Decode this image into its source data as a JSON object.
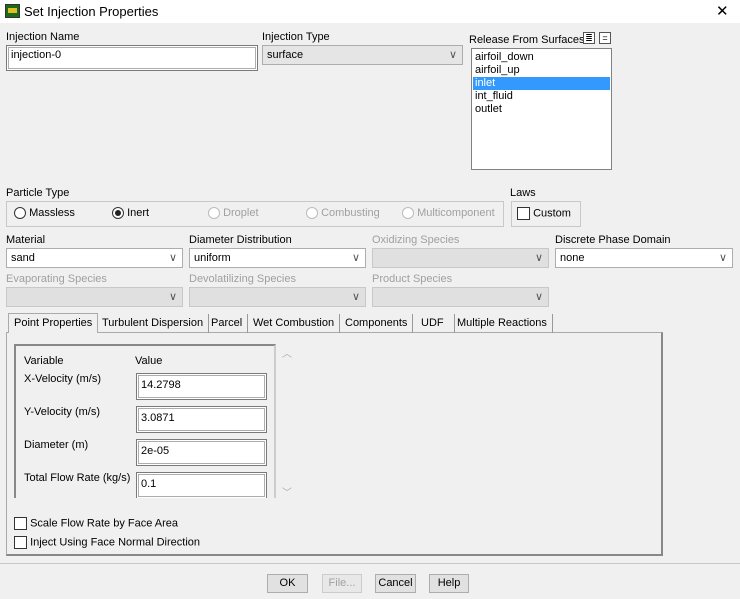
{
  "window": {
    "title": "Set Injection Properties",
    "close": "✕"
  },
  "injection_name": {
    "label": "Injection Name",
    "value": "injection-0"
  },
  "injection_type": {
    "label": "Injection Type",
    "value": "surface"
  },
  "release": {
    "label": "Release From Surfaces",
    "items": [
      "airfoil_down",
      "airfoil_up",
      "inlet",
      "int_fluid",
      "outlet"
    ],
    "selected": "inlet"
  },
  "particle_type": {
    "label": "Particle Type",
    "options": [
      "Massless",
      "Inert",
      "Droplet",
      "Combusting",
      "Multicomponent"
    ],
    "selected": "Inert"
  },
  "laws": {
    "label": "Laws",
    "custom": "Custom"
  },
  "material": {
    "label": "Material",
    "value": "sand"
  },
  "diameter_distribution": {
    "label": "Diameter Distribution",
    "value": "uniform"
  },
  "oxidizing_species": {
    "label": "Oxidizing Species",
    "value": ""
  },
  "discrete_phase_domain": {
    "label": "Discrete Phase Domain",
    "value": "none"
  },
  "evaporating_species": {
    "label": "Evaporating Species"
  },
  "devolatilizing_species": {
    "label": "Devolatilizing Species"
  },
  "product_species": {
    "label": "Product Species"
  },
  "tabs": [
    "Point Properties",
    "Turbulent Dispersion",
    "Parcel",
    "Wet Combustion",
    "Components",
    "UDF",
    "Multiple Reactions"
  ],
  "point_properties": {
    "col_variable": "Variable",
    "col_value": "Value",
    "rows": [
      {
        "label": "X-Velocity (m/s)",
        "value": "14.2798"
      },
      {
        "label": "Y-Velocity (m/s)",
        "value": "3.0871"
      },
      {
        "label": "Diameter (m)",
        "value": "2e-05"
      },
      {
        "label": "Total Flow Rate (kg/s)",
        "value": "0.1"
      }
    ]
  },
  "options": {
    "scale_flow": "Scale Flow Rate by Face Area",
    "inject_normal": "Inject Using Face Normal Direction"
  },
  "buttons": {
    "ok": "OK",
    "file": "File...",
    "cancel": "Cancel",
    "help": "Help"
  }
}
